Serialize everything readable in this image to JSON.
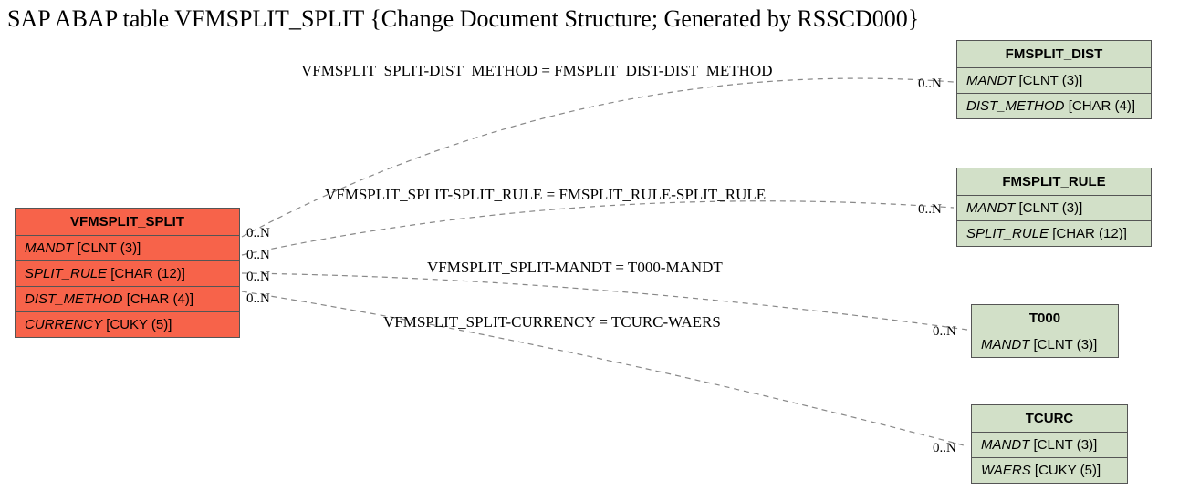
{
  "title": "SAP ABAP table VFMSPLIT_SPLIT {Change Document Structure; Generated by RSSCD000}",
  "main_entity": {
    "name": "VFMSPLIT_SPLIT",
    "fields": [
      {
        "name": "MANDT",
        "type": "[CLNT (3)]"
      },
      {
        "name": "SPLIT_RULE",
        "type": "[CHAR (12)]"
      },
      {
        "name": "DIST_METHOD",
        "type": "[CHAR (4)]"
      },
      {
        "name": "CURRENCY",
        "type": "[CUKY (5)]"
      }
    ]
  },
  "rel_entities": [
    {
      "name": "FMSPLIT_DIST",
      "fields": [
        {
          "name": "MANDT",
          "type": "[CLNT (3)]"
        },
        {
          "name": "DIST_METHOD",
          "type": "[CHAR (4)]"
        }
      ]
    },
    {
      "name": "FMSPLIT_RULE",
      "fields": [
        {
          "name": "MANDT",
          "type": "[CLNT (3)]"
        },
        {
          "name": "SPLIT_RULE",
          "type": "[CHAR (12)]"
        }
      ]
    },
    {
      "name": "T000",
      "fields": [
        {
          "name": "MANDT",
          "type": "[CLNT (3)]"
        }
      ]
    },
    {
      "name": "TCURC",
      "fields": [
        {
          "name": "MANDT",
          "type": "[CLNT (3)]"
        },
        {
          "name": "WAERS",
          "type": "[CUKY (5)]"
        }
      ]
    }
  ],
  "relations": [
    {
      "label": "VFMSPLIT_SPLIT-DIST_METHOD = FMSPLIT_DIST-DIST_METHOD",
      "left_card": "0..N",
      "right_card": "0..N"
    },
    {
      "label": "VFMSPLIT_SPLIT-SPLIT_RULE = FMSPLIT_RULE-SPLIT_RULE",
      "left_card": "0..N",
      "right_card": "0..N"
    },
    {
      "label": "VFMSPLIT_SPLIT-MANDT = T000-MANDT",
      "left_card": "0..N",
      "right_card": "0..N"
    },
    {
      "label": "VFMSPLIT_SPLIT-CURRENCY = TCURC-WAERS",
      "left_card": "0..N",
      "right_card": "0..N"
    }
  ]
}
